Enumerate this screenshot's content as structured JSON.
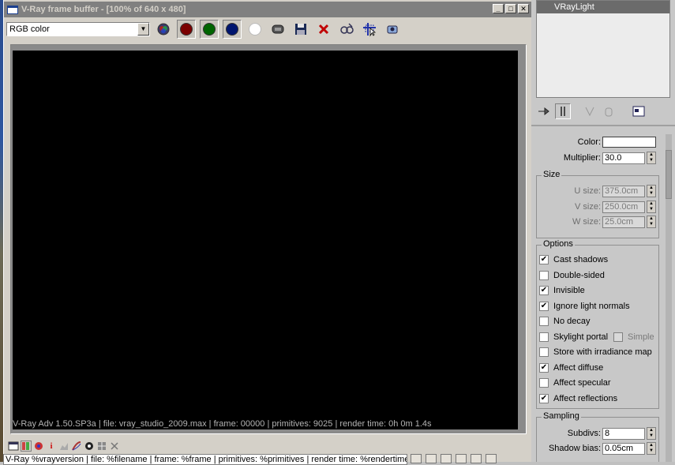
{
  "window": {
    "title": "V-Ray frame buffer - [100% of 640 x 480]",
    "minimize": "_",
    "maximize": "□",
    "close": "✕"
  },
  "toolbar": {
    "channel_value": "RGB color",
    "channel_arrow": "▼"
  },
  "render": {
    "stamp_text": "V-Ray Adv 1.50.SP3a | file: vray_studio_2009.max | frame: 00000 | primitives: 9025 | render time: 0h 0m 1.4s"
  },
  "stamp_template": "V-Ray %vrayversion | file: %filename | frame: %frame | primitives: %primitives | render time: %rendertime",
  "colors": {
    "red_channel": "#7a0000",
    "green_channel": "#006400",
    "blue_channel": "#00156e"
  },
  "panel": {
    "list_selected": "VRayLight",
    "color_label": "Color:",
    "multiplier_label": "Multiplier:",
    "multiplier_value": "30.0",
    "size": {
      "title": "Size",
      "u_label": "U size:",
      "u_value": "375.0cm",
      "v_label": "V size:",
      "v_value": "250.0cm",
      "w_label": "W size:",
      "w_value": "25.0cm"
    },
    "options": {
      "title": "Options",
      "cast_shadows": "Cast shadows",
      "double_sided": "Double-sided",
      "invisible": "Invisible",
      "ignore_light_normals": "Ignore light normals",
      "no_decay": "No decay",
      "skylight_portal": "Skylight portal",
      "simple": "Simple",
      "store_irradiance": "Store with irradiance map",
      "affect_diffuse": "Affect diffuse",
      "affect_specular": "Affect specular",
      "affect_reflections": "Affect reflections",
      "check_mark": "✔"
    },
    "sampling": {
      "title": "Sampling",
      "subdivs_label": "Subdivs:",
      "subdivs_value": "8",
      "shadow_bias_label": "Shadow bias:",
      "shadow_bias_value": "0.05cm"
    }
  }
}
